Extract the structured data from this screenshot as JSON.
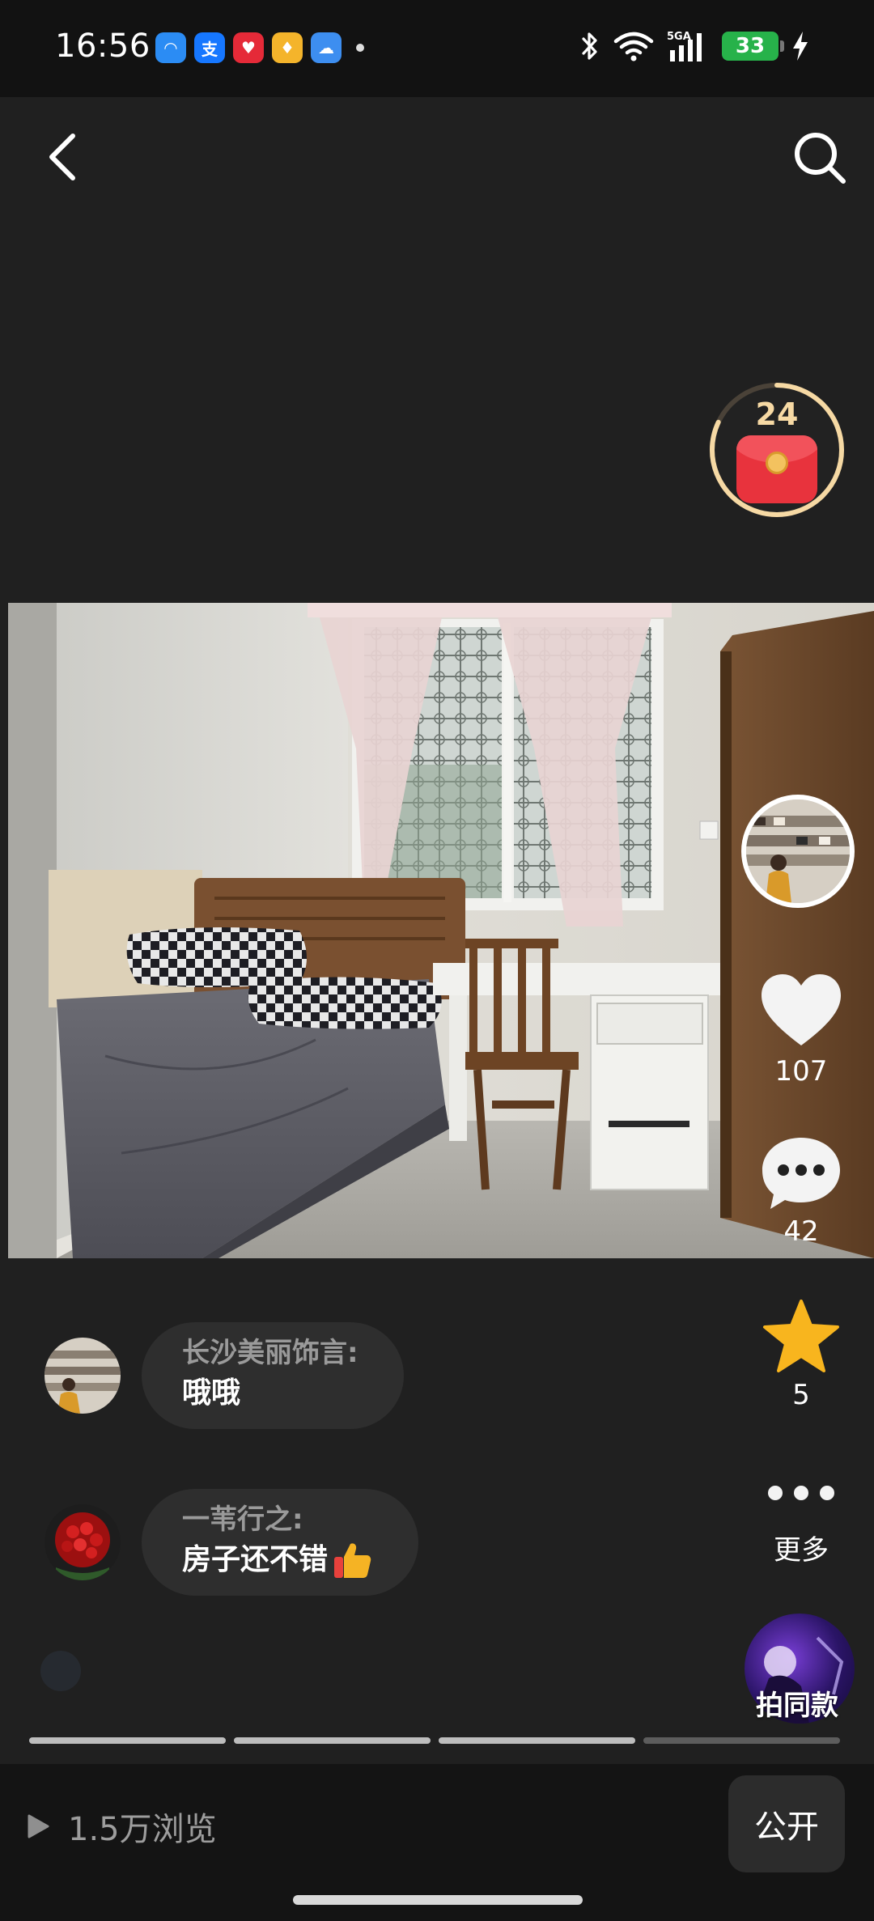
{
  "status_bar": {
    "time": "16:56",
    "apps": [
      {
        "name": "qq-browser-icon",
        "glyph": "◠",
        "bg": "#2b8cf4"
      },
      {
        "name": "alipay-icon",
        "glyph": "支",
        "bg": "#1677ff"
      },
      {
        "name": "health-app-icon",
        "glyph": "♥",
        "bg": "#e52a38"
      },
      {
        "name": "gift-app-icon",
        "glyph": "♦",
        "bg": "#f4b42b"
      },
      {
        "name": "weather-app-icon",
        "glyph": "☁",
        "bg": "#3d8ef0"
      }
    ],
    "network": "5GA",
    "battery": "33"
  },
  "nav": {
    "back_icon": "chevron-left-icon",
    "search_icon": "search-icon"
  },
  "red_packet": {
    "countdown": "24",
    "progress": 0.82,
    "ring_color": "#f6d9a4"
  },
  "actions": {
    "likes": "107",
    "comments": "42",
    "favorites": "5",
    "more_label": "更多"
  },
  "comments": [
    {
      "user": "长沙美丽饰言:",
      "text": "哦哦"
    },
    {
      "user": "一苇行之:",
      "text": "房子还不错"
    }
  ],
  "shoot_same_label": "拍同款",
  "progress_segments": {
    "total": 4,
    "active": 3
  },
  "bottom": {
    "views": "1.5万浏览",
    "public_label": "公开"
  },
  "colors": {
    "star": "#f8b51e",
    "battery": "#27b24a",
    "background": "#202020"
  }
}
